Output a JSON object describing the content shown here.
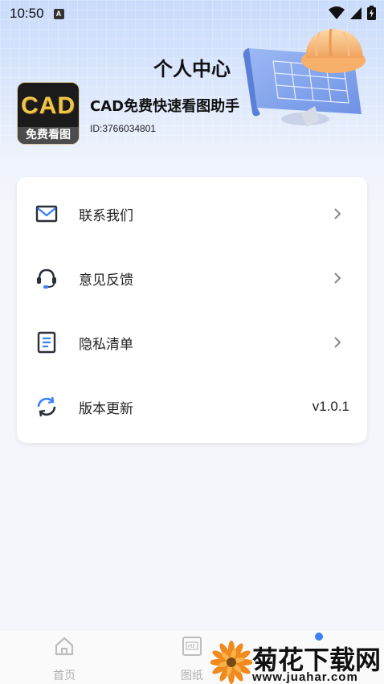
{
  "status_bar": {
    "time": "10:50",
    "badge": "A"
  },
  "header": {
    "title": "个人中心"
  },
  "profile": {
    "logo_text": "CAD",
    "logo_caption": "免费看图",
    "app_name": "CAD免费快速看图助手",
    "user_id": "ID:3766034801"
  },
  "menu": {
    "items": [
      {
        "label": "联系我们",
        "icon": "mail-icon"
      },
      {
        "label": "意见反馈",
        "icon": "headset-icon"
      },
      {
        "label": "隐私清单",
        "icon": "document-list-icon"
      },
      {
        "label": "版本更新",
        "icon": "refresh-icon",
        "value": "v1.0.1"
      }
    ]
  },
  "bottom_nav": {
    "items": [
      {
        "label": "首页",
        "icon": "home-icon"
      },
      {
        "label": "图纸",
        "icon": "cad-drawing-icon"
      }
    ]
  },
  "watermark": {
    "title": "菊花下载网",
    "url": "www.juahar.com"
  },
  "colors": {
    "accent": "#3b82f6",
    "header_bg": "#c9dbfb",
    "icon_dark": "#2b2f3a"
  }
}
